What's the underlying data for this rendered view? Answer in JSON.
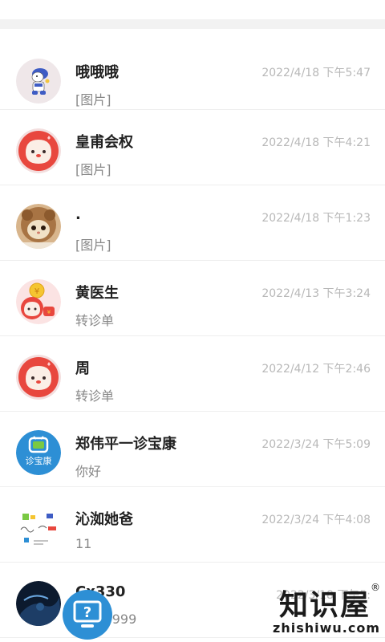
{
  "conversations": [
    {
      "name": "哦哦哦",
      "preview": "[图片]",
      "time": "2022/4/18 下午5:47",
      "avatar": "cartoon-rabbit-avatar"
    },
    {
      "name": "皇甫会权",
      "preview": "[图片]",
      "time": "2022/4/18 下午4:21",
      "avatar": "red-face-avatar"
    },
    {
      "name": ".",
      "preview": "[图片]",
      "time": "2022/4/18 下午1:23",
      "avatar": "cat-hood-avatar"
    },
    {
      "name": "黄医生",
      "preview": "转诊单",
      "time": "2022/4/13 下午3:24",
      "avatar": "coin-avatar"
    },
    {
      "name": "周",
      "preview": "转诊单",
      "time": "2022/4/12 下午2:46",
      "avatar": "red-face-avatar"
    },
    {
      "name": "郑伟平一诊宝康",
      "preview": "你好",
      "time": "2022/3/24 下午5:09",
      "avatar": "zhenbaokang-logo-avatar"
    },
    {
      "name": "沁洳她爸",
      "preview": "11",
      "time": "2022/3/24 下午4:08",
      "avatar": "sketch-avatar"
    },
    {
      "name": "Cx330",
      "preview": "ppp 9999",
      "time": "2022/3/18 下午5:",
      "avatar": "dark-photo-avatar"
    }
  ],
  "avatar_labels": {
    "zhenbaokang": "诊宝康"
  },
  "watermark": {
    "cn": "知识屋",
    "reg": "®",
    "en": "zhishiwu.com"
  },
  "colors": {
    "divider": "#f2f2f2",
    "name": "#222222",
    "preview": "#888888",
    "time": "#b8b8b8",
    "brand_blue": "#2d8fd5",
    "face_red": "#e8473e"
  }
}
